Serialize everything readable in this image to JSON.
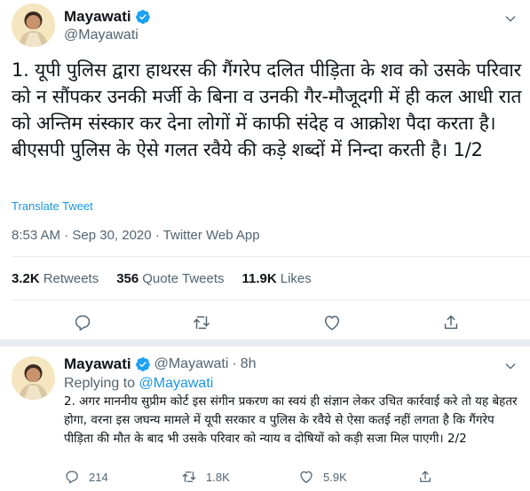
{
  "main_tweet": {
    "author_name": "Mayawati",
    "author_handle": "@Mayawati",
    "text": "1. यूपी पुलिस द्वारा हाथरस की गैंगरेप दलित पीड़िता के शव को उसके परिवार को न सौंपकर उनकी मर्जी के बिना व उनकी गैर-मौजूदगी में ही कल आधी रात को अन्तिम संस्कार कर देना लोगों में काफी संदेह व आक्रोश पैदा करता है। बीएसपी पुलिस के ऐसे गलत रवैये की कड़े शब्दों में निन्दा करती है। 1/2",
    "translate_label": "Translate Tweet",
    "timestamp": "8:53 AM · Sep 30, 2020 · Twitter Web App",
    "stats": {
      "retweets_count": "3.2K",
      "retweets_label": "Retweets",
      "quotes_count": "356",
      "quotes_label": "Quote Tweets",
      "likes_count": "11.9K",
      "likes_label": "Likes"
    }
  },
  "reply_tweet": {
    "author_name": "Mayawati",
    "author_handle": "@Mayawati",
    "dot": "·",
    "time": "8h",
    "replying_prefix": "Replying to",
    "replying_handle": "@Mayawati",
    "text": "2. अगर माननीय सुप्रीम कोर्ट इस संगीन प्रकरण का स्वयं ही संज्ञान लेकर उचित कार्रवाई करे तो यह बेहतर होगा, वरना इस जघन्य मामले में यूपी सरकार व पुलिस के रवैये से ऐसा कतई नहीं लगता है कि गैंगरेप पीड़िता की मौत के बाद भी उसके परिवार को न्याय व दोषियों को कड़ी सजा मिल पाएगी। 2/2",
    "reply_count": "214",
    "retweet_count": "1.8K",
    "like_count": "5.9K"
  },
  "icons": {
    "verified": "verified-badge-icon",
    "more": "chevron-down-icon",
    "reply": "reply-icon",
    "retweet": "retweet-icon",
    "like": "heart-icon",
    "share": "share-icon"
  },
  "colors": {
    "accent": "#1b95e0",
    "verified": "#1da1f2",
    "secondary_text": "#536471",
    "divider": "#e6ecf0"
  }
}
